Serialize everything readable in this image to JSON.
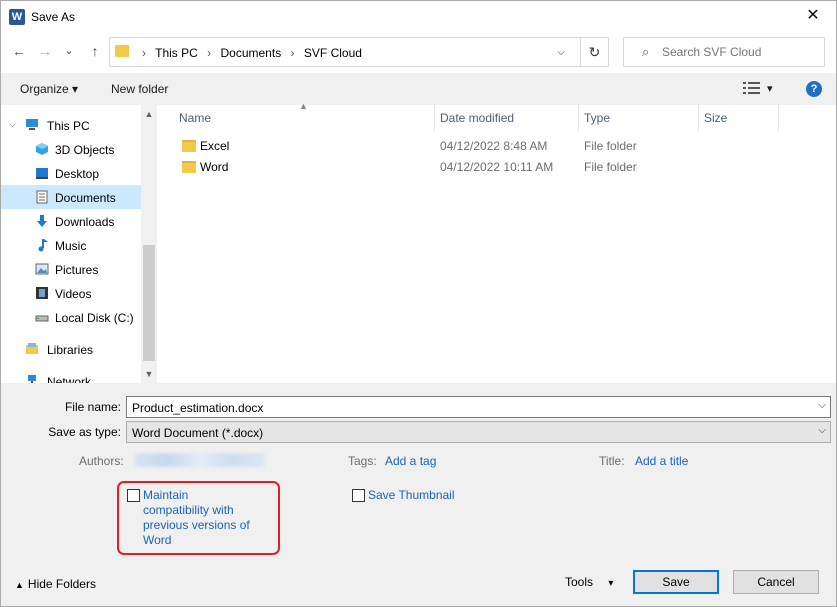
{
  "window": {
    "title": "Save As",
    "app_icon_letter": "W",
    "close_glyph": "✕"
  },
  "nav": {
    "back_glyph": "←",
    "forward_glyph": "→",
    "recent_glyph": "⌄",
    "up_glyph": "↑",
    "breadcrumbs": [
      "This PC",
      "Documents",
      "SVF Cloud"
    ],
    "crumb_sep": "›",
    "search_placeholder": "Search SVF Cloud"
  },
  "toolbar": {
    "organize_label": "Organize ▾",
    "new_folder_label": "New folder",
    "view_dd": "▾",
    "help_label": "?"
  },
  "sidebar": {
    "items": [
      {
        "label": "This PC",
        "icon": "computer-icon",
        "selected": false
      },
      {
        "label": "3D Objects",
        "icon": "cube-icon",
        "selected": false
      },
      {
        "label": "Desktop",
        "icon": "desktop-icon",
        "selected": false
      },
      {
        "label": "Documents",
        "icon": "document-icon",
        "selected": true
      },
      {
        "label": "Downloads",
        "icon": "download-icon",
        "selected": false
      },
      {
        "label": "Music",
        "icon": "music-note-icon",
        "selected": false
      },
      {
        "label": "Pictures",
        "icon": "pictures-icon",
        "selected": false
      },
      {
        "label": "Videos",
        "icon": "film-icon",
        "selected": false
      },
      {
        "label": "Local Disk (C:)",
        "icon": "drive-icon",
        "selected": false
      },
      {
        "label": "Libraries",
        "icon": "libraries-icon",
        "selected": false
      },
      {
        "label": "Network",
        "icon": "network-icon",
        "selected": false
      }
    ]
  },
  "filelist": {
    "columns": [
      "Name",
      "Date modified",
      "Type",
      "Size"
    ],
    "rows": [
      {
        "name": "Excel",
        "date": "04/12/2022 8:48 AM",
        "type": "File folder"
      },
      {
        "name": "Word",
        "date": "04/12/2022 10:11 AM",
        "type": "File folder"
      }
    ]
  },
  "form": {
    "filename_label": "File name:",
    "filename_value": "Product_estimation.docx",
    "savetype_label": "Save as type:",
    "savetype_value": "Word Document (*.docx)",
    "authors_label": "Authors:",
    "tags_label": "Tags:",
    "tags_link": "Add a tag",
    "title_label": "Title:",
    "title_link": "Add a title",
    "compat_line1": "Maintain",
    "compat_line2": "compatibility with",
    "compat_line3": "previous versions of",
    "compat_line4": "Word",
    "thumbnail_label": "Save Thumbnail"
  },
  "footer": {
    "hide_folders_label": "Hide Folders",
    "tools_label": "Tools",
    "tools_dd": "▾",
    "save_label": "Save",
    "cancel_label": "Cancel"
  },
  "colors": {
    "accent": "#0078d7",
    "link": "#1a64b8",
    "highlight_box": "#e01f25",
    "selected_row": "#cce8ff"
  }
}
